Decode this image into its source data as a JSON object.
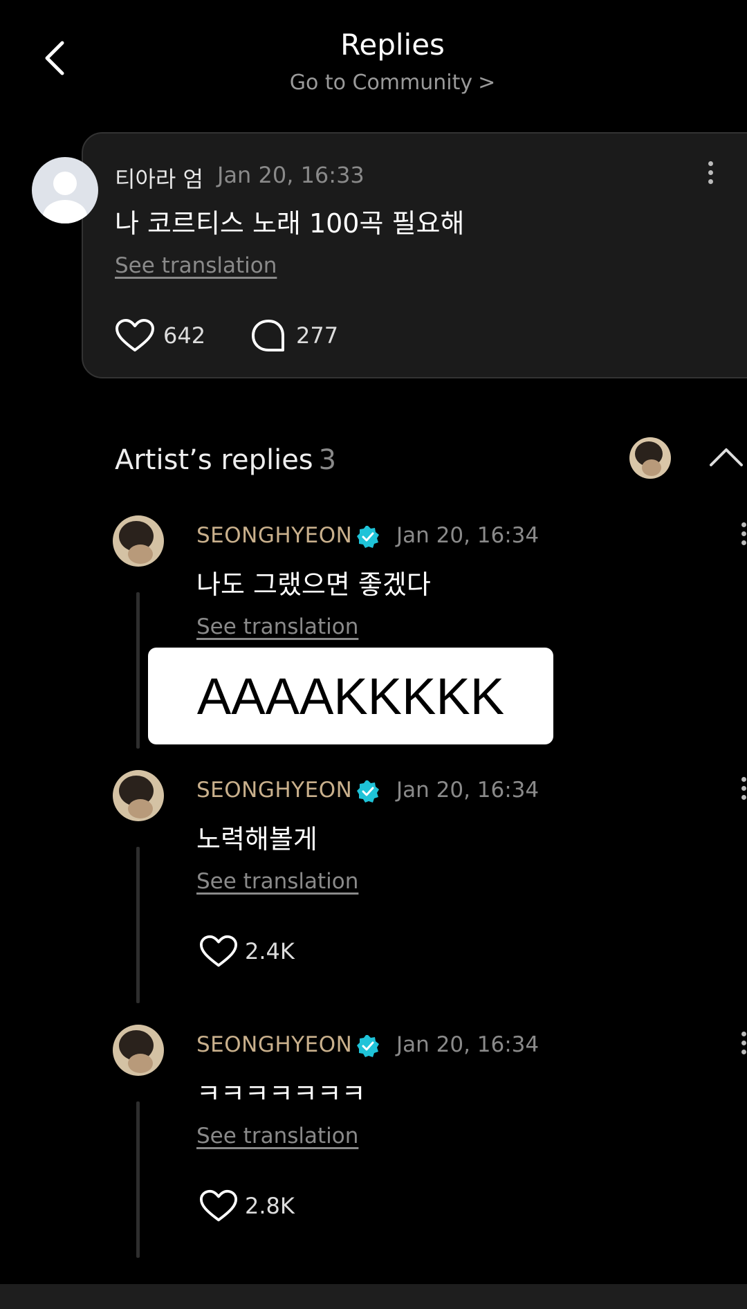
{
  "header": {
    "title": "Replies",
    "subtitle": "Go to Community",
    "subtitle_chevron": ">"
  },
  "comment": {
    "author": "티아라 엄",
    "time": "Jan 20, 16:33",
    "text": "나 코르티스 노래 100곡 필요해",
    "see_translation": "See translation",
    "likes": "642",
    "replies": "277"
  },
  "artist_replies": {
    "title": "Artist’s replies",
    "count": "3",
    "items": [
      {
        "name": "SEONGHYEON",
        "time": "Jan 20, 16:34",
        "text": "나도 그랬으면 좋겠다",
        "see_translation": "See translation"
      },
      {
        "name": "SEONGHYEON",
        "time": "Jan 20, 16:34",
        "text": "노력해볼게",
        "see_translation": "See translation",
        "likes": "2.4K"
      },
      {
        "name": "SEONGHYEON",
        "time": "Jan 20, 16:34",
        "text": "ㅋㅋㅋㅋㅋㅋㅋ",
        "see_translation": "See translation",
        "likes": "2.8K"
      }
    ]
  },
  "overlay_caption": "AAAAKKKKK",
  "colors": {
    "background": "#000000",
    "card": "#1b1b1b",
    "artist_name": "#c9b08c",
    "verified_badge": "#1fc3d8",
    "muted_text": "#8a8a8a"
  }
}
